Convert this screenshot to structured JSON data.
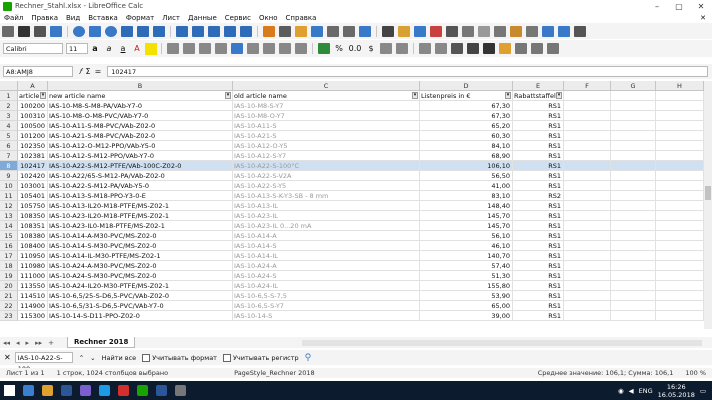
{
  "window": {
    "title": "Rechner_Stahl.xlsx - LibreOffice Calc",
    "min": "–",
    "max": "▢",
    "close": "✕"
  },
  "menu": [
    "Файл",
    "Правка",
    "Вид",
    "Вставка",
    "Формат",
    "Лист",
    "Данные",
    "Сервис",
    "Окно",
    "Справка"
  ],
  "menu_close": "✕",
  "font": {
    "name": "Calibri",
    "size": "11"
  },
  "format_buttons": [
    "%",
    "0.0",
    "$"
  ],
  "formula": {
    "cell_ref": "A8:AMJ8",
    "value": "102417",
    "sigma": "Σ",
    "equals": "="
  },
  "columns": [
    "A",
    "B",
    "C",
    "D",
    "E",
    "F",
    "G",
    "H"
  ],
  "header_row": {
    "rownum": "1",
    "cells": [
      "article",
      "new article name",
      "old article name",
      "Listenpreis in €",
      "Rabattstaffel",
      "",
      "",
      ""
    ]
  },
  "rows": [
    {
      "rownum": "2",
      "a": "100200",
      "b": "IAS-10-M8-S-M8-PA/VAb-Y7-0",
      "c": "IAS-10-M8-S-Y7",
      "d": "67,30",
      "e": "RS1"
    },
    {
      "rownum": "3",
      "a": "100310",
      "b": "IAS-10-M8-O-M8-PVC/VAb-Y7-0",
      "c": "IAS-10-M8-O-Y7",
      "d": "67,30",
      "e": "RS1"
    },
    {
      "rownum": "4",
      "a": "100500",
      "b": "IAS-10-A11-S-M8-PVC/VAb-Z02-0",
      "c": "IAS-10-A11-S",
      "d": "65,20",
      "e": "RS1"
    },
    {
      "rownum": "5",
      "a": "101200",
      "b": "IAS-10-A21-S-M8-PVC/VAb-Z02-0",
      "c": "IAS-10-A21-S",
      "d": "60,30",
      "e": "RS1"
    },
    {
      "rownum": "6",
      "a": "102350",
      "b": "IAS-10-A12-O-M12-PPO/VAb-Y5-0",
      "c": "IAS-10-A12-O-Y5",
      "d": "84,10",
      "e": "RS1"
    },
    {
      "rownum": "7",
      "a": "102381",
      "b": "IAS-10-A12-S-M12-PPO/VAb-Y7-0",
      "c": "IAS-10-A12-S-Y7",
      "d": "68,90",
      "e": "RS1"
    },
    {
      "rownum": "8",
      "a": "102417",
      "b": "IAS-10-A22-S-M12-PTFE/VAb-100C-Z02-0",
      "c": "IAS-10-A22-S-100°C",
      "d": "106,10",
      "e": "RS1",
      "selected": true
    },
    {
      "rownum": "9",
      "a": "102420",
      "b": "IAS-10-A22/65-S-M12-PA/VAb-Z02-0",
      "c": "IAS-10-A22-S-V2A",
      "d": "56,50",
      "e": "RS1"
    },
    {
      "rownum": "10",
      "a": "103001",
      "b": "IAS-10-A22-S-M12-PA/VAb-Y5-0",
      "c": "IAS-10-A22-S-Y5",
      "d": "41,00",
      "e": "RS1"
    },
    {
      "rownum": "11",
      "a": "105401",
      "b": "IAS-10-A13-S-M18-PPO-Y3-0-E",
      "c": "IAS-10-A13-S-K-Y3-SB - 8 mm",
      "d": "83,10",
      "e": "RS2"
    },
    {
      "rownum": "12",
      "a": "105750",
      "b": "IAS-10-A13-IL20-M18-PTFE/MS-Z02-1",
      "c": "IAS-10-A13-IL",
      "d": "148,40",
      "e": "RS1"
    },
    {
      "rownum": "13",
      "a": "108350",
      "b": "IAS-10-A23-IL20-M18-PTFE/MS-Z02-1",
      "c": "IAS-10-A23-IL",
      "d": "145,70",
      "e": "RS1"
    },
    {
      "rownum": "14",
      "a": "108351",
      "b": "IAS-10-A23-IL0-M18-PTFE/MS-Z02-1",
      "c": "IAS-10-A23-IL 0...20 mA",
      "d": "145,70",
      "e": "RS1"
    },
    {
      "rownum": "15",
      "a": "108380",
      "b": "IAS-10-A14-A-M30-PVC/MS-Z02-0",
      "c": "IAS-10-A14-A",
      "d": "56,10",
      "e": "RS1"
    },
    {
      "rownum": "16",
      "a": "108400",
      "b": "IAS-10-A14-S-M30-PVC/MS-Z02-0",
      "c": "IAS-10-A14-S",
      "d": "46,10",
      "e": "RS1"
    },
    {
      "rownum": "17",
      "a": "110950",
      "b": "IAS-10-A14-IL-M30-PTFE/MS-Z02-1",
      "c": "IAS-10-A14-IL",
      "d": "140,70",
      "e": "RS1"
    },
    {
      "rownum": "18",
      "a": "110980",
      "b": "IAS-10-A24-A-M30-PVC/MS-Z02-0",
      "c": "IAS-10-A24-A",
      "d": "57,40",
      "e": "RS1"
    },
    {
      "rownum": "19",
      "a": "111000",
      "b": "IAS-10-A24-S-M30-PVC/MS-Z02-0",
      "c": "IAS-10-A24-S",
      "d": "51,30",
      "e": "RS1"
    },
    {
      "rownum": "20",
      "a": "113550",
      "b": "IAS-10-A24-IL20-M30-PTFE/MS-Z02-1",
      "c": "IAS-10-A24-IL",
      "d": "155,80",
      "e": "RS1"
    },
    {
      "rownum": "21",
      "a": "114510",
      "b": "IAS-10-6,5/25-S-D6,5-PVC/VAb-Z02-0",
      "c": "IAS-10-6,5-S-7,5",
      "d": "53,90",
      "e": "RS1"
    },
    {
      "rownum": "22",
      "a": "114900",
      "b": "IAS-10-6,5/31-S-D6,5-PVC/VAb-Y7-0",
      "c": "IAS-10-6,5-S-Y7",
      "d": "65,00",
      "e": "RS1"
    },
    {
      "rownum": "23",
      "a": "115300",
      "b": "IAS-10-14-S-D11-PPO-Z02-0",
      "c": "IAS-10-14-S",
      "d": "39,00",
      "e": "RS1"
    }
  ],
  "sheet": {
    "tab": "Rechner 2018",
    "nav": [
      "◂◂",
      "◂",
      "▸",
      "▸▸",
      "+"
    ]
  },
  "find": {
    "value": "IAS-10-A22-S-100",
    "find_all": "Найти все",
    "match_format": "Учитывать формат",
    "match_case": "Учитывать регистр"
  },
  "status": {
    "sheet": "Лист 1 из 1",
    "selection": "1 строк, 1024 столбцов выбрано",
    "style": "PageStyle_Rechner 2018",
    "sum": "Среднее значение: 106,1; Сумма: 106,1",
    "zoom": "100 %"
  },
  "taskbar": {
    "lang": "ENG",
    "time": "16:26",
    "date": "16.05.2018"
  },
  "colors": {
    "selected_row": "#cfe0f3",
    "toolbar_bg": "#f4f4f4",
    "taskbar_bg": "#0d1b2e"
  }
}
